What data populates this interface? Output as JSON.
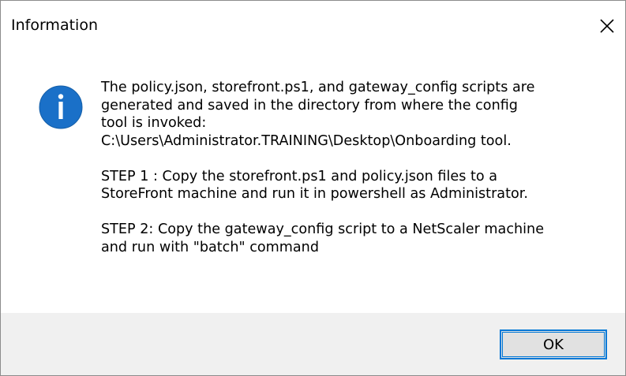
{
  "window": {
    "title": "Information",
    "close_icon": "close-icon"
  },
  "message": {
    "icon": "info-icon",
    "icon_color": "#1a70c8",
    "paragraph1": [
      "The policy.json, storefront.ps1, and gateway_config scripts are",
      "generated and saved in the directory from where the config",
      "tool is invoked:",
      "C:\\Users\\Administrator.TRAINING\\Desktop\\Onboarding tool."
    ],
    "paragraph2": [
      "STEP 1 : Copy the storefront.ps1 and policy.json files to a",
      "StoreFront machine and run it in powershell as Administrator."
    ],
    "paragraph3": [
      "STEP 2: Copy the gateway_config script to a NetScaler machine",
      "and run with \"batch\" command"
    ]
  },
  "footer": {
    "ok_label": "OK",
    "accent": "#0078d7",
    "background": "#f0f0f0"
  }
}
